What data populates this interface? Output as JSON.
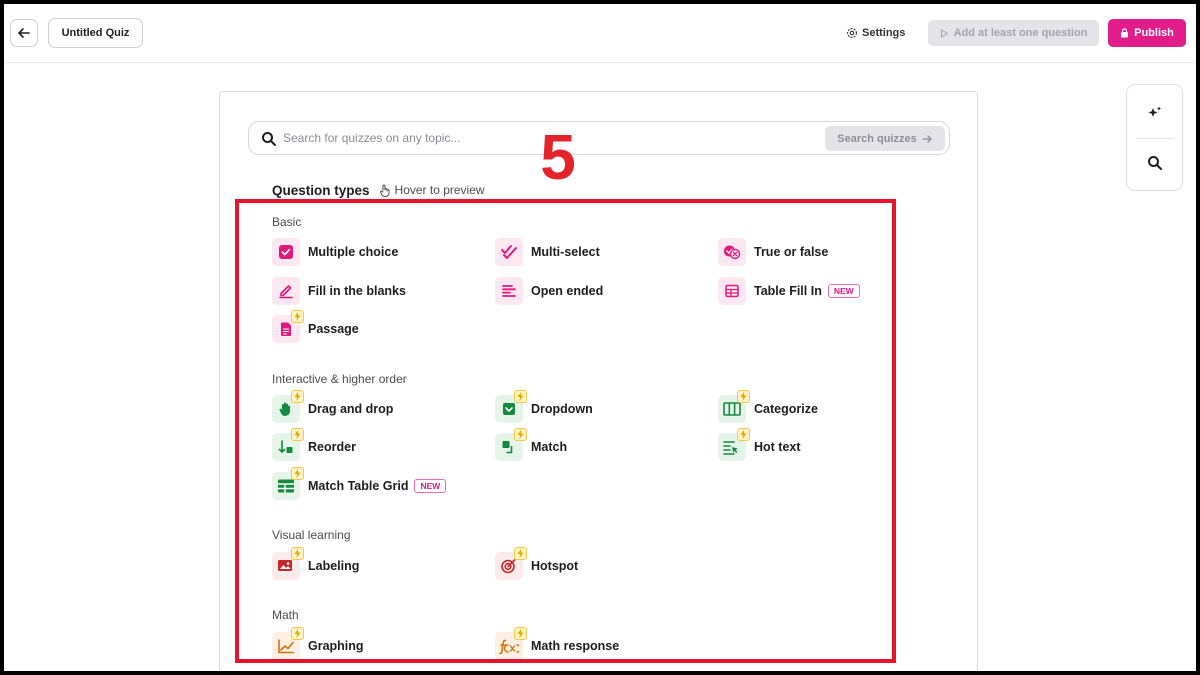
{
  "header": {
    "title": "Untitled Quiz",
    "settings_label": "Settings",
    "add_question_label": "Add at least one question",
    "publish_label": "Publish"
  },
  "search": {
    "placeholder": "Search for quizzes on any topic...",
    "button_label": "Search quizzes"
  },
  "question_types": {
    "title": "Question types",
    "hover_hint": "Hover to preview"
  },
  "sections": {
    "basic": {
      "label": "Basic",
      "items": [
        "Multiple choice",
        "Multi-select",
        "True or false",
        "Fill in the blanks",
        "Open ended",
        "Table Fill In",
        "Passage"
      ]
    },
    "interactive": {
      "label": "Interactive & higher order",
      "items": [
        "Drag and drop",
        "Dropdown",
        "Categorize",
        "Reorder",
        "Match",
        "Hot text",
        "Match Table Grid"
      ]
    },
    "visual": {
      "label": "Visual learning",
      "items": [
        "Labeling",
        "Hotspot"
      ]
    },
    "math": {
      "label": "Math",
      "items": [
        "Graphing",
        "Math response"
      ]
    }
  },
  "badges": {
    "new": "NEW"
  },
  "annotation": {
    "number": "5"
  },
  "colors": {
    "accent": "#e01d8a",
    "pink_icon": "#e0197d",
    "green_icon": "#138a3e",
    "red_icon": "#c62828",
    "orange_icon": "#d4700f",
    "annotation": "#e8132d"
  }
}
